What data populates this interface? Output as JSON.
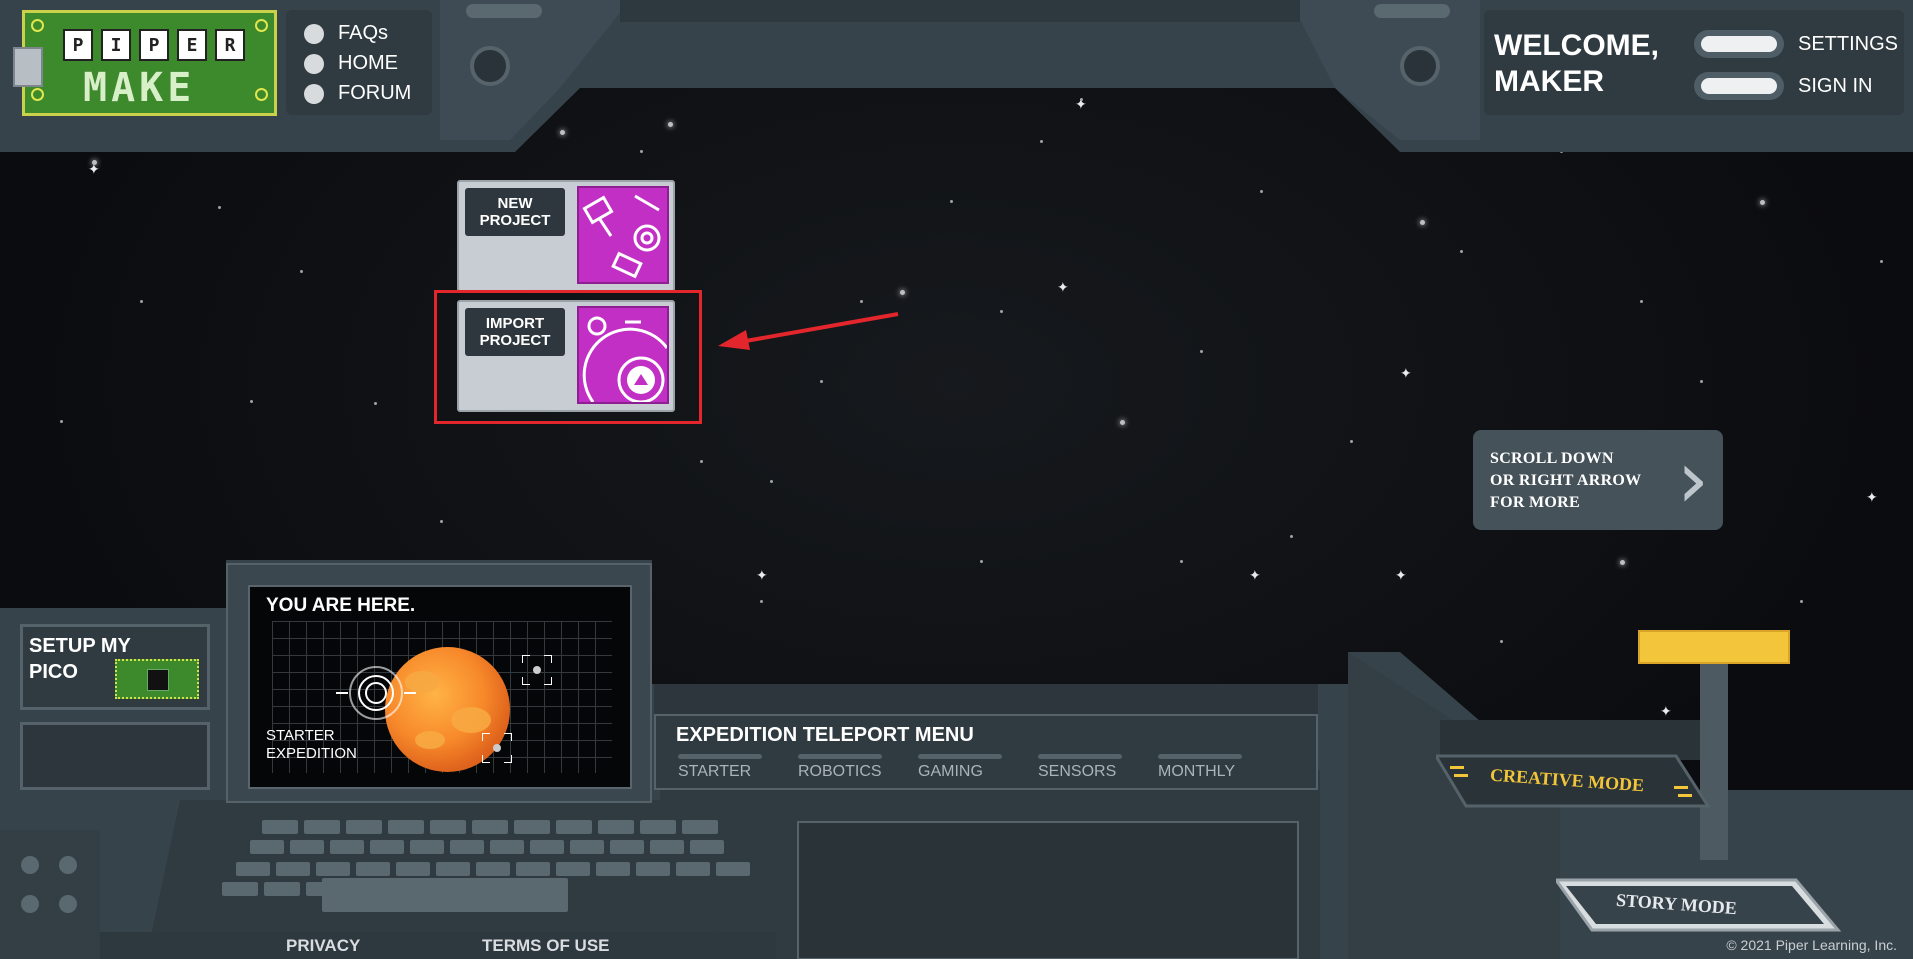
{
  "logo": {
    "letters": [
      "P",
      "I",
      "P",
      "E",
      "R"
    ],
    "word": "MAKE"
  },
  "nav": {
    "items": [
      {
        "label": "FAQs"
      },
      {
        "label": "HOME"
      },
      {
        "label": "FORUM"
      }
    ]
  },
  "welcome": {
    "line1": "WELCOME,",
    "line2": "MAKER"
  },
  "account": {
    "settings_label": "SETTINGS",
    "signin_label": "SIGN IN"
  },
  "projects": {
    "new": {
      "line1": "NEW",
      "line2": "PROJECT"
    },
    "import": {
      "line1": "IMPORT",
      "line2": "PROJECT"
    }
  },
  "scroll_hint": {
    "line1": "SCROLL DOWN",
    "line2": "OR RIGHT ARROW",
    "line3": "FOR MORE"
  },
  "monitor": {
    "heading": "YOU ARE HERE.",
    "location_line1": "STARTER",
    "location_line2": "EXPEDITION"
  },
  "pico": {
    "line1": "SETUP MY",
    "line2": "PICO"
  },
  "expedition": {
    "title": "EXPEDITION TELEPORT MENU",
    "tabs": [
      "STARTER",
      "ROBOTICS",
      "GAMING",
      "SENSORS",
      "MONTHLY"
    ]
  },
  "modes": {
    "creative": "CREATIVE MODE",
    "story": "STORY MODE"
  },
  "footer": {
    "privacy": "PRIVACY",
    "terms": "TERMS OF USE",
    "copyright": "© 2021 Piper Learning, Inc."
  },
  "colors": {
    "accent": "#c22fc4",
    "highlight": "#e3262b",
    "lever": "#f3c53a",
    "panel": "#37434b"
  }
}
